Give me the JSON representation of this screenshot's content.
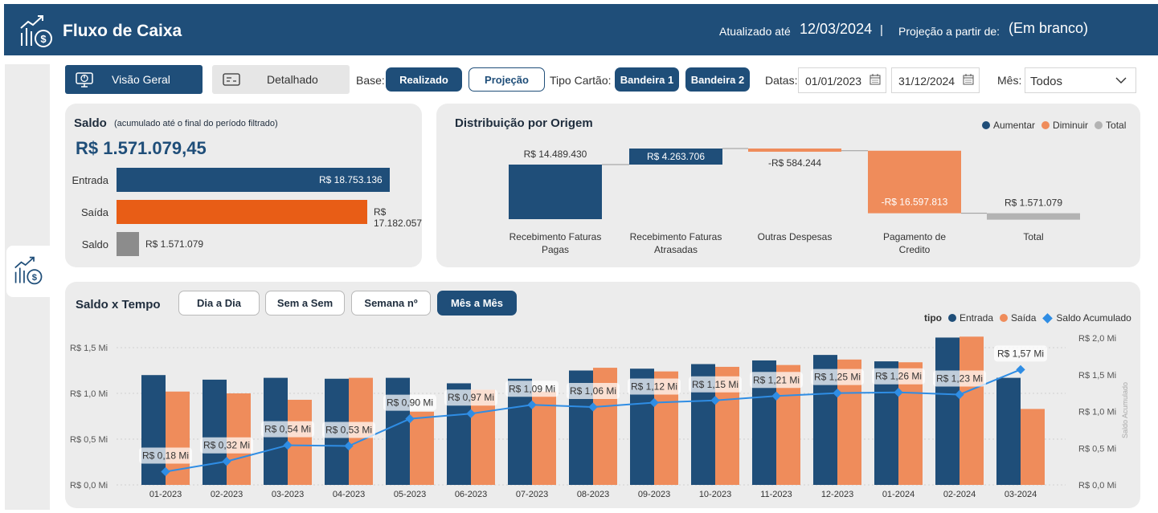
{
  "header": {
    "title": "Fluxo de Caixa",
    "updated_label": "Atualizado até",
    "updated_value": "12/03/2024",
    "separator": "|",
    "projection_label": "Projeção a partir de:",
    "projection_value": "(Em branco)"
  },
  "nav": {
    "visao_geral": "Visão Geral",
    "detalhado": "Detalhado"
  },
  "filters": {
    "base_label": "Base:",
    "base_options": [
      "Realizado",
      "Projeção"
    ],
    "base_selected": "Realizado",
    "tipo_cartao_label": "Tipo Cartão:",
    "bandeiras": [
      "Bandeira 1",
      "Bandeira 2"
    ],
    "datas_label": "Datas:",
    "date_from": "01/01/2023",
    "date_to": "31/12/2024",
    "mes_label": "Mês:",
    "mes_value": "Todos"
  },
  "saldo_card": {
    "title": "Saldo",
    "subtitle": "(acumulado até o  final do período filtrado)",
    "value": "R$ 1.571.079,45",
    "bars": [
      {
        "label": "Entrada",
        "value": 18753136,
        "display": "R$ 18.753.136",
        "color": "#1f4e79"
      },
      {
        "label": "Saída",
        "value": 17182057,
        "display": "R$ 17.182.057",
        "color": "#e85d16"
      },
      {
        "label": "Saldo",
        "value": 1571079,
        "display": "R$ 1.571.079",
        "color": "#8c8c8c"
      }
    ]
  },
  "dist_card": {
    "title": "Distribuição por Origem",
    "legend": [
      {
        "label": "Aumentar",
        "color": "#1f4e79"
      },
      {
        "label": "Diminuir",
        "color": "#ef8c5b"
      },
      {
        "label": "Total",
        "color": "#b3b3b3"
      }
    ],
    "chart_data": {
      "type": "bar",
      "categories": [
        "Recebimento Faturas Pagas",
        "Recebimento Faturas Atrasadas",
        "Outras Despesas",
        "Pagamento de Credito",
        "Total"
      ],
      "values": [
        14489430,
        4263706,
        -584244,
        -16597813,
        1571079
      ],
      "labels": [
        "R$ 14.489.430",
        "R$ 4.263.706",
        "-R$ 584.244",
        "-R$ 16.597.813",
        "R$ 1.571.079"
      ],
      "kinds": [
        "increase",
        "increase",
        "decrease",
        "decrease",
        "total"
      ]
    }
  },
  "time_card": {
    "title": "Saldo x Tempo",
    "toggles": [
      "Dia a Dia",
      "Sem a Sem",
      "Semana nº",
      "Mês a Mês"
    ],
    "toggle_selected": "Mês a Mês",
    "legend_title": "tipo",
    "legend": [
      {
        "label": "Entrada",
        "color": "#1f4e79"
      },
      {
        "label": "Saída",
        "color": "#ef8c5b"
      },
      {
        "label": "Saldo Acumulado",
        "color": "#2f8de4"
      }
    ],
    "chart_data": {
      "type": "bar",
      "categories": [
        "01-2023",
        "02-2023",
        "03-2023",
        "04-2023",
        "05-2023",
        "06-2023",
        "07-2023",
        "08-2023",
        "09-2023",
        "10-2023",
        "11-2023",
        "12-2023",
        "01-2024",
        "02-2024",
        "03-2024"
      ],
      "series": [
        {
          "name": "Entrada",
          "values": [
            1.2,
            1.15,
            1.17,
            1.16,
            1.17,
            1.11,
            1.16,
            1.25,
            1.27,
            1.32,
            1.36,
            1.42,
            1.35,
            1.61,
            1.17
          ]
        },
        {
          "name": "Saída",
          "values": [
            1.02,
            1.0,
            0.93,
            1.17,
            0.8,
            1.04,
            1.02,
            1.28,
            1.24,
            1.29,
            1.31,
            1.37,
            1.34,
            1.62,
            0.83
          ]
        },
        {
          "name": "Saldo Acumulado",
          "values": [
            0.18,
            0.32,
            0.54,
            0.53,
            0.9,
            0.97,
            1.09,
            1.06,
            1.12,
            1.15,
            1.21,
            1.25,
            1.26,
            1.23,
            1.57
          ]
        }
      ],
      "point_labels": [
        "R$ 0,18 Mi",
        "R$ 0,32 Mi",
        "R$ 0,54 Mi",
        "R$ 0,53 Mi",
        "R$ 0,90 Mi",
        "R$ 0,97 Mi",
        "R$ 1,09 Mi",
        "R$ 1,06 Mi",
        "R$ 1,12 Mi",
        "R$ 1,15 Mi",
        "R$ 1,21 Mi",
        "R$ 1,25 Mi",
        "R$ 1,26 Mi",
        "R$ 1,23 Mi",
        "R$ 1,57 Mi"
      ],
      "y_left_ticks": [
        "R$ 0,0 Mi",
        "R$ 0,5 Mi",
        "R$ 1,0 Mi",
        "R$ 1,5 Mi"
      ],
      "y_right_ticks": [
        "R$ 0,0 Mi",
        "R$ 0,5 Mi",
        "R$ 1,0 Mi",
        "R$ 1,5 Mi",
        "R$ 2,0 Mi"
      ],
      "y_right_label": "Saldo Acumulado",
      "ylim_left": [
        0,
        1.5
      ],
      "ylim_right": [
        0,
        2.0
      ]
    }
  }
}
